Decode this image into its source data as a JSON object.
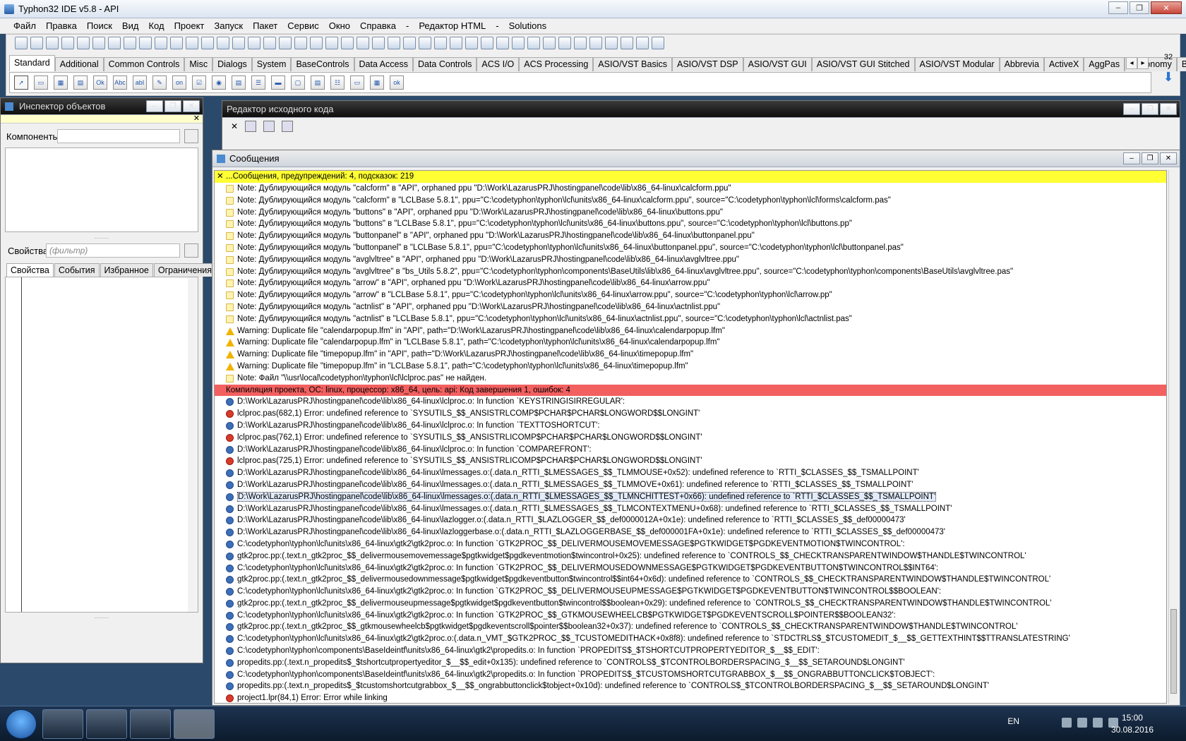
{
  "window": {
    "title": "Typhon32 IDE v5.8 - API",
    "controls": {
      "min": "–",
      "max": "❐",
      "close": "✕"
    }
  },
  "menu": [
    "Файл",
    "Правка",
    "Поиск",
    "Вид",
    "Код",
    "Проект",
    "Запуск",
    "Пакет",
    "Сервис",
    "Окно",
    "Справка",
    "-",
    "Редактор HTML",
    "-",
    "Solutions"
  ],
  "palette_tabs": [
    "Standard",
    "Additional",
    "Common Controls",
    "Misc",
    "Dialogs",
    "System",
    "BaseControls",
    "Data Access",
    "Data Controls",
    "ACS I/O",
    "ACS Processing",
    "ASIO/VST Basics",
    "ASIO/VST DSP",
    "ASIO/VST GUI",
    "ASIO/VST GUI Stitched",
    "ASIO/VST Modular",
    "Abbrevia",
    "ActiveX",
    "AggPas",
    "Astronomy",
    "BGRA Control"
  ],
  "palette_tab_scroll": {
    "left": "◂",
    "right": "▸"
  },
  "palette_side_number": "32",
  "palette_items": [
    "▭",
    "▦",
    "▤",
    "Ok",
    "Abc",
    "abI",
    "✎",
    "on",
    "☑",
    "◉",
    "▤",
    "☰",
    "▬",
    "▢",
    "▤",
    "☷",
    "▭",
    "▦",
    "ok"
  ],
  "inspector": {
    "title": "Инспектор объектов",
    "components_label": "Компоненты",
    "props_label": "Свойства",
    "filter_placeholder": "(фильтр)",
    "tabs": [
      "Свойства",
      "События",
      "Избранное",
      "Ограничения"
    ]
  },
  "editor": {
    "title": "Редактор исходного кода"
  },
  "messages": {
    "title": "Сообщения",
    "header": "...Сообщения, предупреждений: 4, подсказок: 219",
    "close_glyph": "✕",
    "rows": [
      {
        "type": "note",
        "text": "Note: Дублирующийся модуль \"calcform\" в \"API\", orphaned ppu \"D:\\Work\\LazarusPRJ\\hostingpanel\\code\\lib\\x86_64-linux\\calcform.ppu\""
      },
      {
        "type": "note",
        "text": "Note: Дублирующийся модуль \"calcform\" в \"LCLBase 5.8.1\", ppu=\"C:\\codetyphon\\typhon\\lcl\\units\\x86_64-linux\\calcform.ppu\", source=\"C:\\codetyphon\\typhon\\lcl\\forms\\calcform.pas\""
      },
      {
        "type": "note",
        "text": "Note: Дублирующийся модуль \"buttons\" в \"API\", orphaned ppu \"D:\\Work\\LazarusPRJ\\hostingpanel\\code\\lib\\x86_64-linux\\buttons.ppu\""
      },
      {
        "type": "note",
        "text": "Note: Дублирующийся модуль \"buttons\" в \"LCLBase 5.8.1\", ppu=\"C:\\codetyphon\\typhon\\lcl\\units\\x86_64-linux\\buttons.ppu\", source=\"C:\\codetyphon\\typhon\\lcl\\buttons.pp\""
      },
      {
        "type": "note",
        "text": "Note: Дублирующийся модуль \"buttonpanel\" в \"API\", orphaned ppu \"D:\\Work\\LazarusPRJ\\hostingpanel\\code\\lib\\x86_64-linux\\buttonpanel.ppu\""
      },
      {
        "type": "note",
        "text": "Note: Дублирующийся модуль \"buttonpanel\" в \"LCLBase 5.8.1\", ppu=\"C:\\codetyphon\\typhon\\lcl\\units\\x86_64-linux\\buttonpanel.ppu\", source=\"C:\\codetyphon\\typhon\\lcl\\buttonpanel.pas\""
      },
      {
        "type": "note",
        "text": "Note: Дублирующийся модуль \"avglvltree\" в \"API\", orphaned ppu \"D:\\Work\\LazarusPRJ\\hostingpanel\\code\\lib\\x86_64-linux\\avglvltree.ppu\""
      },
      {
        "type": "note",
        "text": "Note: Дублирующийся модуль \"avglvltree\" в \"bs_Utils 5.8.2\", ppu=\"C:\\codetyphon\\typhon\\components\\BaseUtils\\lib\\x86_64-linux\\avglvltree.ppu\", source=\"C:\\codetyphon\\typhon\\components\\BaseUtils\\avglvltree.pas\""
      },
      {
        "type": "note",
        "text": "Note: Дублирующийся модуль \"arrow\" в \"API\", orphaned ppu \"D:\\Work\\LazarusPRJ\\hostingpanel\\code\\lib\\x86_64-linux\\arrow.ppu\""
      },
      {
        "type": "note",
        "text": "Note: Дублирующийся модуль \"arrow\" в \"LCLBase 5.8.1\", ppu=\"C:\\codetyphon\\typhon\\lcl\\units\\x86_64-linux\\arrow.ppu\", source=\"C:\\codetyphon\\typhon\\lcl\\arrow.pp\""
      },
      {
        "type": "note",
        "text": "Note: Дублирующийся модуль \"actnlist\" в \"API\", orphaned ppu \"D:\\Work\\LazarusPRJ\\hostingpanel\\code\\lib\\x86_64-linux\\actnlist.ppu\""
      },
      {
        "type": "note",
        "text": "Note: Дублирующийся модуль \"actnlist\" в \"LCLBase 5.8.1\", ppu=\"C:\\codetyphon\\typhon\\lcl\\units\\x86_64-linux\\actnlist.ppu\", source=\"C:\\codetyphon\\typhon\\lcl\\actnlist.pas\""
      },
      {
        "type": "warn",
        "text": "Warning: Duplicate file \"calendarpopup.lfm\" in \"API\", path=\"D:\\Work\\LazarusPRJ\\hostingpanel\\code\\lib\\x86_64-linux\\calendarpopup.lfm\""
      },
      {
        "type": "warn",
        "text": "Warning: Duplicate file \"calendarpopup.lfm\" in \"LCLBase 5.8.1\", path=\"C:\\codetyphon\\typhon\\lcl\\units\\x86_64-linux\\calendarpopup.lfm\""
      },
      {
        "type": "warn",
        "text": "Warning: Duplicate file \"timepopup.lfm\" in \"API\", path=\"D:\\Work\\LazarusPRJ\\hostingpanel\\code\\lib\\x86_64-linux\\timepopup.lfm\""
      },
      {
        "type": "warn",
        "text": "Warning: Duplicate file \"timepopup.lfm\" in \"LCLBase 5.8.1\", path=\"C:\\codetyphon\\typhon\\lcl\\units\\x86_64-linux\\timepopup.lfm\""
      },
      {
        "type": "note",
        "text": "Note: Файл \"\\\\usr\\local\\codetyphon\\typhon\\lcl\\lclproc.pas\" не найден."
      },
      {
        "type": "compile",
        "text": "Компиляция проекта, ОС: linux, процессор: x86_64, цель: api: Код завершения 1, ошибок: 4"
      },
      {
        "type": "info",
        "text": "D:\\Work\\LazarusPRJ\\hostingpanel\\code\\lib\\x86_64-linux\\lclproc.o: In function `KEYSTRINGISIRREGULAR':"
      },
      {
        "type": "err",
        "text": "lclproc.pas(682,1) Error: undefined reference to `SYSUTILS_$$_ANSISTRLCOMP$PCHAR$PCHAR$LONGWORD$$LONGINT'"
      },
      {
        "type": "info",
        "text": "D:\\Work\\LazarusPRJ\\hostingpanel\\code\\lib\\x86_64-linux\\lclproc.o: In function `TEXTTOSHORTCUT':"
      },
      {
        "type": "err",
        "text": "lclproc.pas(762,1) Error: undefined reference to `SYSUTILS_$$_ANSISTRLICOMP$PCHAR$PCHAR$LONGWORD$$LONGINT'"
      },
      {
        "type": "info",
        "text": "D:\\Work\\LazarusPRJ\\hostingpanel\\code\\lib\\x86_64-linux\\lclproc.o: In function `COMPAREFRONT':"
      },
      {
        "type": "err",
        "text": "lclproc.pas(725,1) Error: undefined reference to `SYSUTILS_$$_ANSISTRLICOMP$PCHAR$PCHAR$LONGWORD$$LONGINT'"
      },
      {
        "type": "info",
        "text": "D:\\Work\\LazarusPRJ\\hostingpanel\\code\\lib\\x86_64-linux\\lmessages.o:(.data.n_RTTI_$LMESSAGES_$$_TLMMOUSE+0x52): undefined reference to `RTTI_$CLASSES_$$_TSMALLPOINT'"
      },
      {
        "type": "info",
        "text": "D:\\Work\\LazarusPRJ\\hostingpanel\\code\\lib\\x86_64-linux\\lmessages.o:(.data.n_RTTI_$LMESSAGES_$$_TLMMOVE+0x61): undefined reference to `RTTI_$CLASSES_$$_TSMALLPOINT'"
      },
      {
        "type": "info",
        "selected": true,
        "text": "D:\\Work\\LazarusPRJ\\hostingpanel\\code\\lib\\x86_64-linux\\lmessages.o:(.data.n_RTTI_$LMESSAGES_$$_TLMNCHITTEST+0x66): undefined reference to `RTTI_$CLASSES_$$_TSMALLPOINT'"
      },
      {
        "type": "info",
        "text": "D:\\Work\\LazarusPRJ\\hostingpanel\\code\\lib\\x86_64-linux\\lmessages.o:(.data.n_RTTI_$LMESSAGES_$$_TLMCONTEXTMENU+0x68): undefined reference to `RTTI_$CLASSES_$$_TSMALLPOINT'"
      },
      {
        "type": "info",
        "text": "D:\\Work\\LazarusPRJ\\hostingpanel\\code\\lib\\x86_64-linux\\lazlogger.o:(.data.n_RTTI_$LAZLOGGER_$$_def0000012A+0x1e): undefined reference to `RTTI_$CLASSES_$$_def00000473'"
      },
      {
        "type": "info",
        "text": "D:\\Work\\LazarusPRJ\\hostingpanel\\code\\lib\\x86_64-linux\\lazloggerbase.o:(.data.n_RTTI_$LAZLOGGERBASE_$$_def000001FA+0x1e): undefined reference to `RTTI_$CLASSES_$$_def00000473'"
      },
      {
        "type": "info",
        "text": "C:\\codetyphon\\typhon\\lcl\\units\\x86_64-linux\\gtk2\\gtk2proc.o: In function `GTK2PROC_$$_DELIVERMOUSEMOVEMESSAGE$PGTKWIDGET$PGDKEVENTMOTION$TWINCONTROL':"
      },
      {
        "type": "info",
        "text": "gtk2proc.pp:(.text.n_gtk2proc_$$_delivermousemovemessage$pgtkwidget$pgdkeventmotion$twincontrol+0x25): undefined reference to `CONTROLS_$$_CHECKTRANSPARENTWINDOW$THANDLE$TWINCONTROL'"
      },
      {
        "type": "info",
        "text": "C:\\codetyphon\\typhon\\lcl\\units\\x86_64-linux\\gtk2\\gtk2proc.o: In function `GTK2PROC_$$_DELIVERMOUSEDOWNMESSAGE$PGTKWIDGET$PGDKEVENTBUTTON$TWINCONTROL$$INT64':"
      },
      {
        "type": "info",
        "text": "gtk2proc.pp:(.text.n_gtk2proc_$$_delivermousedownmessage$pgtkwidget$pgdkeventbutton$twincontrol$$int64+0x6d): undefined reference to `CONTROLS_$$_CHECKTRANSPARENTWINDOW$THANDLE$TWINCONTROL'"
      },
      {
        "type": "info",
        "text": "C:\\codetyphon\\typhon\\lcl\\units\\x86_64-linux\\gtk2\\gtk2proc.o: In function `GTK2PROC_$$_DELIVERMOUSEUPMESSAGE$PGTKWIDGET$PGDKEVENTBUTTON$TWINCONTROL$$BOOLEAN':"
      },
      {
        "type": "info",
        "text": "gtk2proc.pp:(.text.n_gtk2proc_$$_delivermouseupmessage$pgtkwidget$pgdkeventbutton$twincontrol$$boolean+0x29): undefined reference to `CONTROLS_$$_CHECKTRANSPARENTWINDOW$THANDLE$TWINCONTROL'"
      },
      {
        "type": "info",
        "text": "C:\\codetyphon\\typhon\\lcl\\units\\x86_64-linux\\gtk2\\gtk2proc.o: In function `GTK2PROC_$$_GTKMOUSEWHEELCB$PGTKWIDGET$PGDKEVENTSCROLL$POINTER$$BOOLEAN32':"
      },
      {
        "type": "info",
        "text": "gtk2proc.pp:(.text.n_gtk2proc_$$_gtkmousewheelcb$pgtkwidget$pgdkeventscroll$pointer$$boolean32+0x37): undefined reference to `CONTROLS_$$_CHECKTRANSPARENTWINDOW$THANDLE$TWINCONTROL'"
      },
      {
        "type": "info",
        "text": "C:\\codetyphon\\typhon\\lcl\\units\\x86_64-linux\\gtk2\\gtk2proc.o:(.data.n_VMT_$GTK2PROC_$$_TCUSTOMEDITHACK+0x8f8): undefined reference to `STDCTRLS$_$TCUSTOMEDIT_$__$$_GETTEXTHINT$$TTRANSLATESTRING'"
      },
      {
        "type": "info",
        "text": "C:\\codetyphon\\typhon\\components\\BaseIdeintf\\units\\x86_64-linux\\gtk2\\propedits.o: In function `PROPEDITS$_$TSHORTCUTPROPERTYEDITOR_$__$$_EDIT':"
      },
      {
        "type": "info",
        "text": "propedits.pp:(.text.n_propedits$_$tshortcutpropertyeditor_$__$$_edit+0x135): undefined reference to `CONTROLS$_$TCONTROLBORDERSPACING_$__$$_SETAROUND$LONGINT'"
      },
      {
        "type": "info",
        "text": "C:\\codetyphon\\typhon\\components\\BaseIdeintf\\units\\x86_64-linux\\gtk2\\propedits.o: In function `PROPEDITS$_$TCUSTOMSHORTCUTGRABBOX_$__$$_ONGRABBUTTONCLICK$TOBJECT':"
      },
      {
        "type": "info",
        "text": "propedits.pp:(.text.n_propedits$_$tcustomshortcutgrabbox_$__$$_ongrabbuttonclick$tobject+0x10d): undefined reference to `CONTROLS$_$TCONTROLBORDERSPACING_$__$$_SETAROUND$LONGINT'"
      },
      {
        "type": "err",
        "text": "project1.lpr(84,1) Error: Error while linking"
      }
    ]
  },
  "taskbar": {
    "lang": "EN",
    "time": "15:00",
    "date": "30.08.2016"
  },
  "colors": {
    "header_yellow": "#ffff33",
    "compile_red": "#f26060"
  }
}
